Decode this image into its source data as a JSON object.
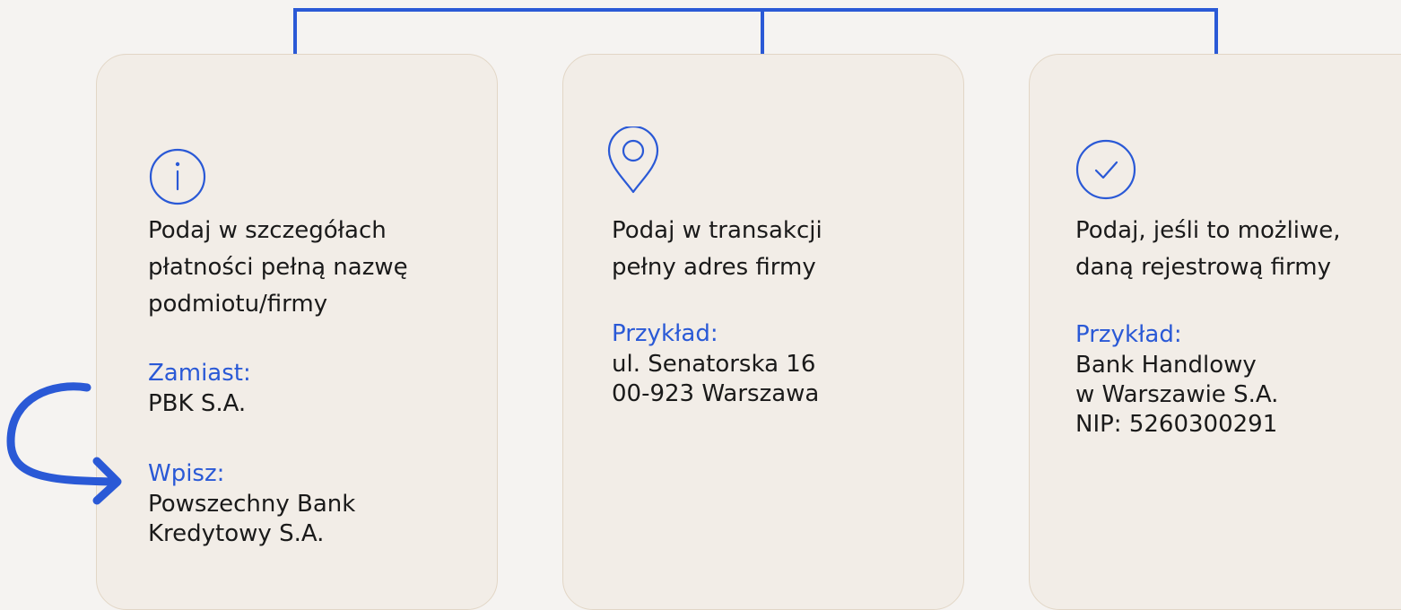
{
  "accent_color": "#2a59d6",
  "card_background": "#f2ede7",
  "cards": [
    {
      "icon": "info-icon",
      "title": "Podaj w szczegółach\npłatności pełną nazwę\npodmiotu/firmy",
      "example_label": "Zamiast:",
      "example_value": "PBK S.A.",
      "correct_label": "Wpisz:",
      "correct_value": "Powszechny Bank\nKredytowy S.A."
    },
    {
      "icon": "location-pin-icon",
      "title": "Podaj w transakcji\npełny adres firmy",
      "example_label": "Przykład:",
      "example_value": "ul. Senatorska 16\n00-923 Warszawa"
    },
    {
      "icon": "checkmark-circle-icon",
      "title": "Podaj, jeśli to możliwe,\ndaną rejestrową firmy",
      "example_label": "Przykład:",
      "example_value": "Bank Handlowy\nw Warszawie S.A.\nNIP: 5260300291"
    }
  ]
}
